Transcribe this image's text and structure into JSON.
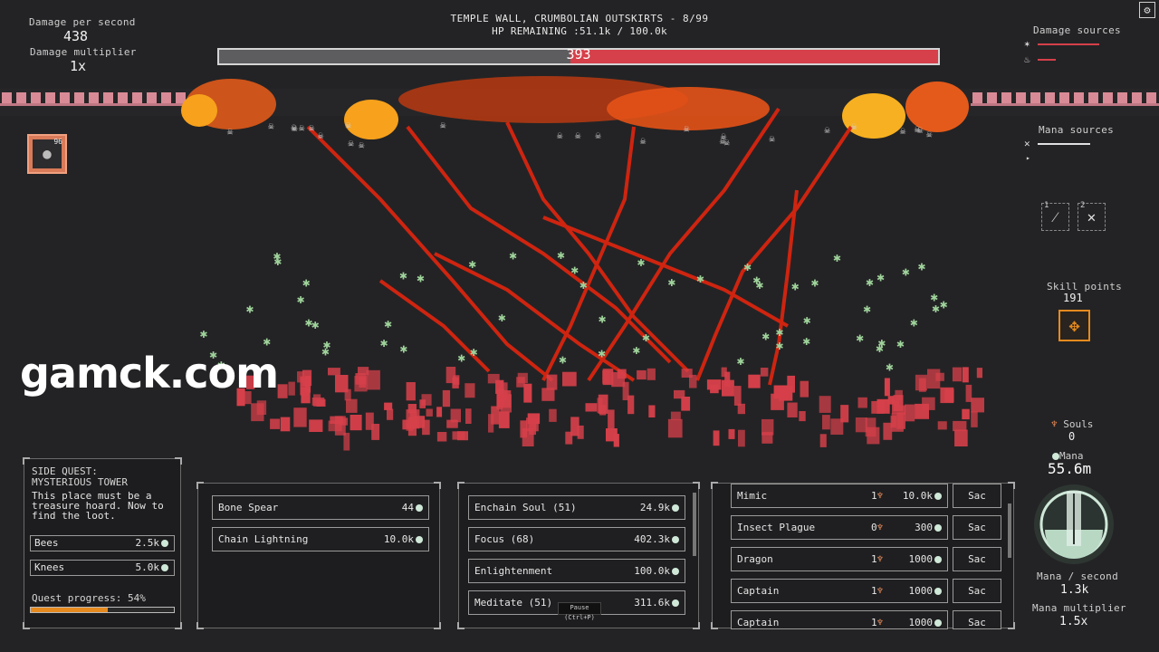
{
  "stats": {
    "dps_label": "Damage per second",
    "dps_value": "438",
    "multiplier_label": "Damage multiplier",
    "multiplier_value": "1x"
  },
  "level": {
    "title": "TEMPLE WALL, CRUMBOLIAN OUTSKIRTS - 8/99",
    "hp_text": "HP REMAINING :51.1k / 100.0k",
    "hp_bar_value": "393",
    "hp_fraction": 0.511,
    "hp_color": "#d6404a"
  },
  "item": {
    "count": "96",
    "icon": "bomb-icon"
  },
  "damage_sources": {
    "label": "Damage sources"
  },
  "mana_sources": {
    "label": "Mana sources"
  },
  "abilities": [
    {
      "key": "1",
      "icon": "sword-slash-icon"
    },
    {
      "key": "2",
      "icon": "cross-icon"
    }
  ],
  "skill_points": {
    "label": "Skill points",
    "value": "191"
  },
  "watermark": "gamck.com",
  "souls": {
    "label": "Souls",
    "value": "0"
  },
  "mana": {
    "label": "Mana",
    "value": "55.6m",
    "per_second_label": "Mana / second",
    "per_second_value": "1.3k",
    "multiplier_label": "Mana multiplier",
    "multiplier_value": "1.5x"
  },
  "quest": {
    "title": "SIDE QUEST:\nMYSTERIOUS TOWER",
    "description": "This place must be a treasure hoard. Now to find the loot.",
    "rows": [
      {
        "name": "Bees",
        "value": "2.5k"
      },
      {
        "name": "Knees",
        "value": "5.0k"
      }
    ],
    "progress_label": "Quest progress: 54%",
    "progress_fraction": 0.54
  },
  "spells": [
    {
      "name": "Bone Spear",
      "value": "44"
    },
    {
      "name": "Chain Lightning",
      "value": "10.0k"
    }
  ],
  "skills": [
    {
      "name": "Enchain Soul (51)",
      "value": "24.9k"
    },
    {
      "name": "Focus (68)",
      "value": "402.3k"
    },
    {
      "name": "Enlightenment",
      "value": "100.0k"
    },
    {
      "name": "Meditate (51)",
      "value": "311.6k"
    }
  ],
  "pause_tooltip": "Pause (Ctrl+P)",
  "summons": [
    {
      "name": "Mimic",
      "souls": "1",
      "cost": "10.0k",
      "sac": "Sac"
    },
    {
      "name": "Insect Plague",
      "souls": "0",
      "cost": "300",
      "sac": "Sac"
    },
    {
      "name": "Dragon",
      "souls": "1",
      "cost": "1000",
      "sac": "Sac"
    },
    {
      "name": "Captain",
      "souls": "1",
      "cost": "1000",
      "sac": "Sac"
    },
    {
      "name": "Captain",
      "souls": "1",
      "cost": "1000",
      "sac": "Sac"
    }
  ],
  "colors": {
    "background": "#232325",
    "accent_orange": "#e58a1e",
    "enemy_red": "#d6404a",
    "ally_green": "#9fd39b",
    "lightning_red": "#d8250f"
  }
}
